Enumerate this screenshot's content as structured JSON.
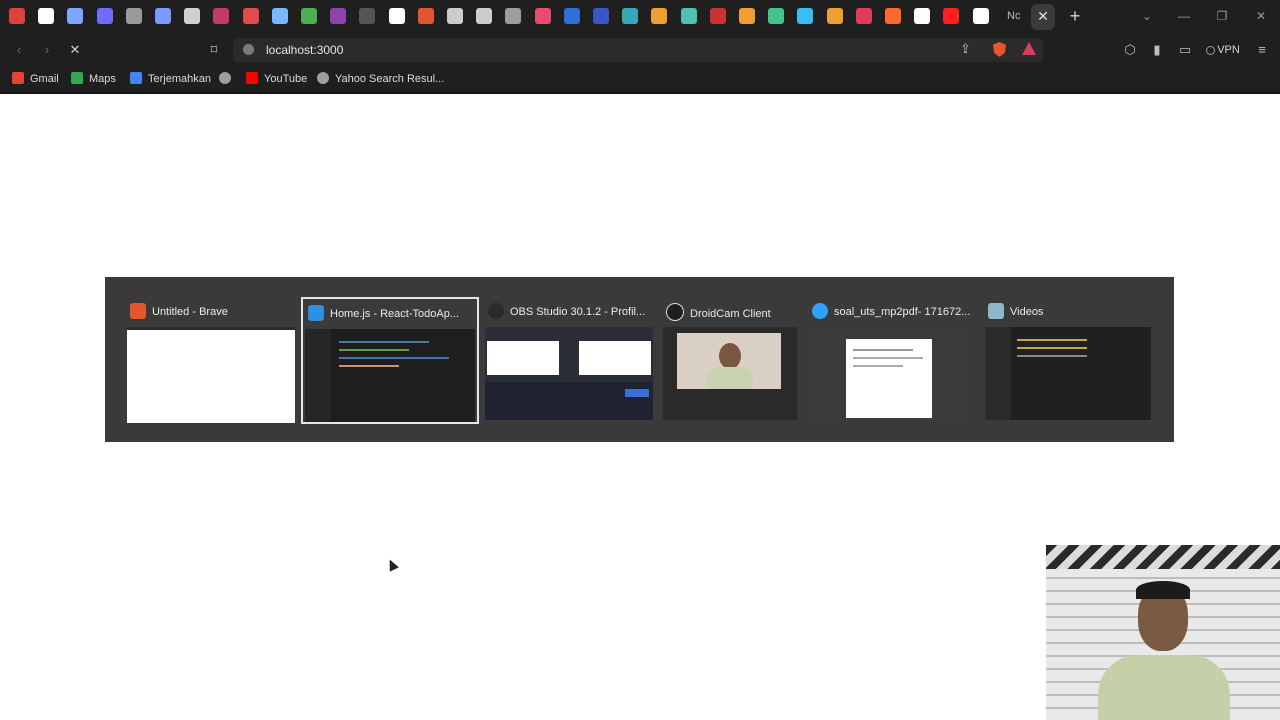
{
  "browser": {
    "tab_title_fragment": "Nc",
    "tab_icon_colors": [
      "#d9453b",
      "#ffffff",
      "#7ea6ff",
      "#6f6bff",
      "#9a9a9a",
      "#7a9cff",
      "#cfcfcf",
      "#c23b66",
      "#e24b4b",
      "#7ab7ff",
      "#4caf50",
      "#8e44ad",
      "#555555",
      "#ffffff",
      "#e2562f",
      "#cccccc",
      "#cccccc",
      "#9e9e9e",
      "#e84a74",
      "#2f6fd7",
      "#3957c7",
      "#3aa6b9",
      "#f0a030",
      "#4fc1b0",
      "#c83333",
      "#f0a030",
      "#42c38f",
      "#38bdf8",
      "#f0a030",
      "#e13a5a",
      "#ff6a2b",
      "#ffffff",
      "#ff1f1f",
      "#ffffff"
    ],
    "new_tab_icon": "+",
    "window_controls": {
      "dropdown": "⌄",
      "minimize": "—",
      "restore": "❐",
      "close": "✕"
    },
    "toolbar": {
      "back_icon": "‹",
      "forward_icon": "›",
      "reload_icon": "✕",
      "bookmark_icon": "⌑",
      "url": "localhost:3000",
      "share_icon": "⇪",
      "extensions_icon": "⬡",
      "sidebar_icon": "▮",
      "wallet_icon": "▭",
      "vpn_label": "VPN",
      "menu_icon": "≡"
    },
    "bookmarks": [
      {
        "label": "Gmail",
        "color": "#ea4335"
      },
      {
        "label": "Maps",
        "color": "#34a853"
      },
      {
        "label": "Terjemahkan",
        "color": "#4285f4"
      },
      {
        "label": "",
        "color": "#9e9e9e"
      },
      {
        "label": "YouTube",
        "color": "#ff0000"
      },
      {
        "label": "Yahoo Search Resul...",
        "color": "#9e9e9e"
      }
    ]
  },
  "switcher": {
    "windows": [
      {
        "title": "Untitled - Brave",
        "color": "#e8542e",
        "selected": false
      },
      {
        "title": "Home.js - React-TodoAp...",
        "color": "#2f8fe0",
        "selected": true
      },
      {
        "title": "OBS Studio 30.1.2 - Profil...",
        "color": "#2a2a2a",
        "selected": false
      },
      {
        "title": "DroidCam Client",
        "color": "#1f1f1f",
        "selected": false
      },
      {
        "title": "soal_uts_mp2pdf- 171672...",
        "color": "#2ea0ff",
        "selected": false
      },
      {
        "title": "Videos",
        "color": "#8fb8c8",
        "selected": false
      }
    ]
  }
}
